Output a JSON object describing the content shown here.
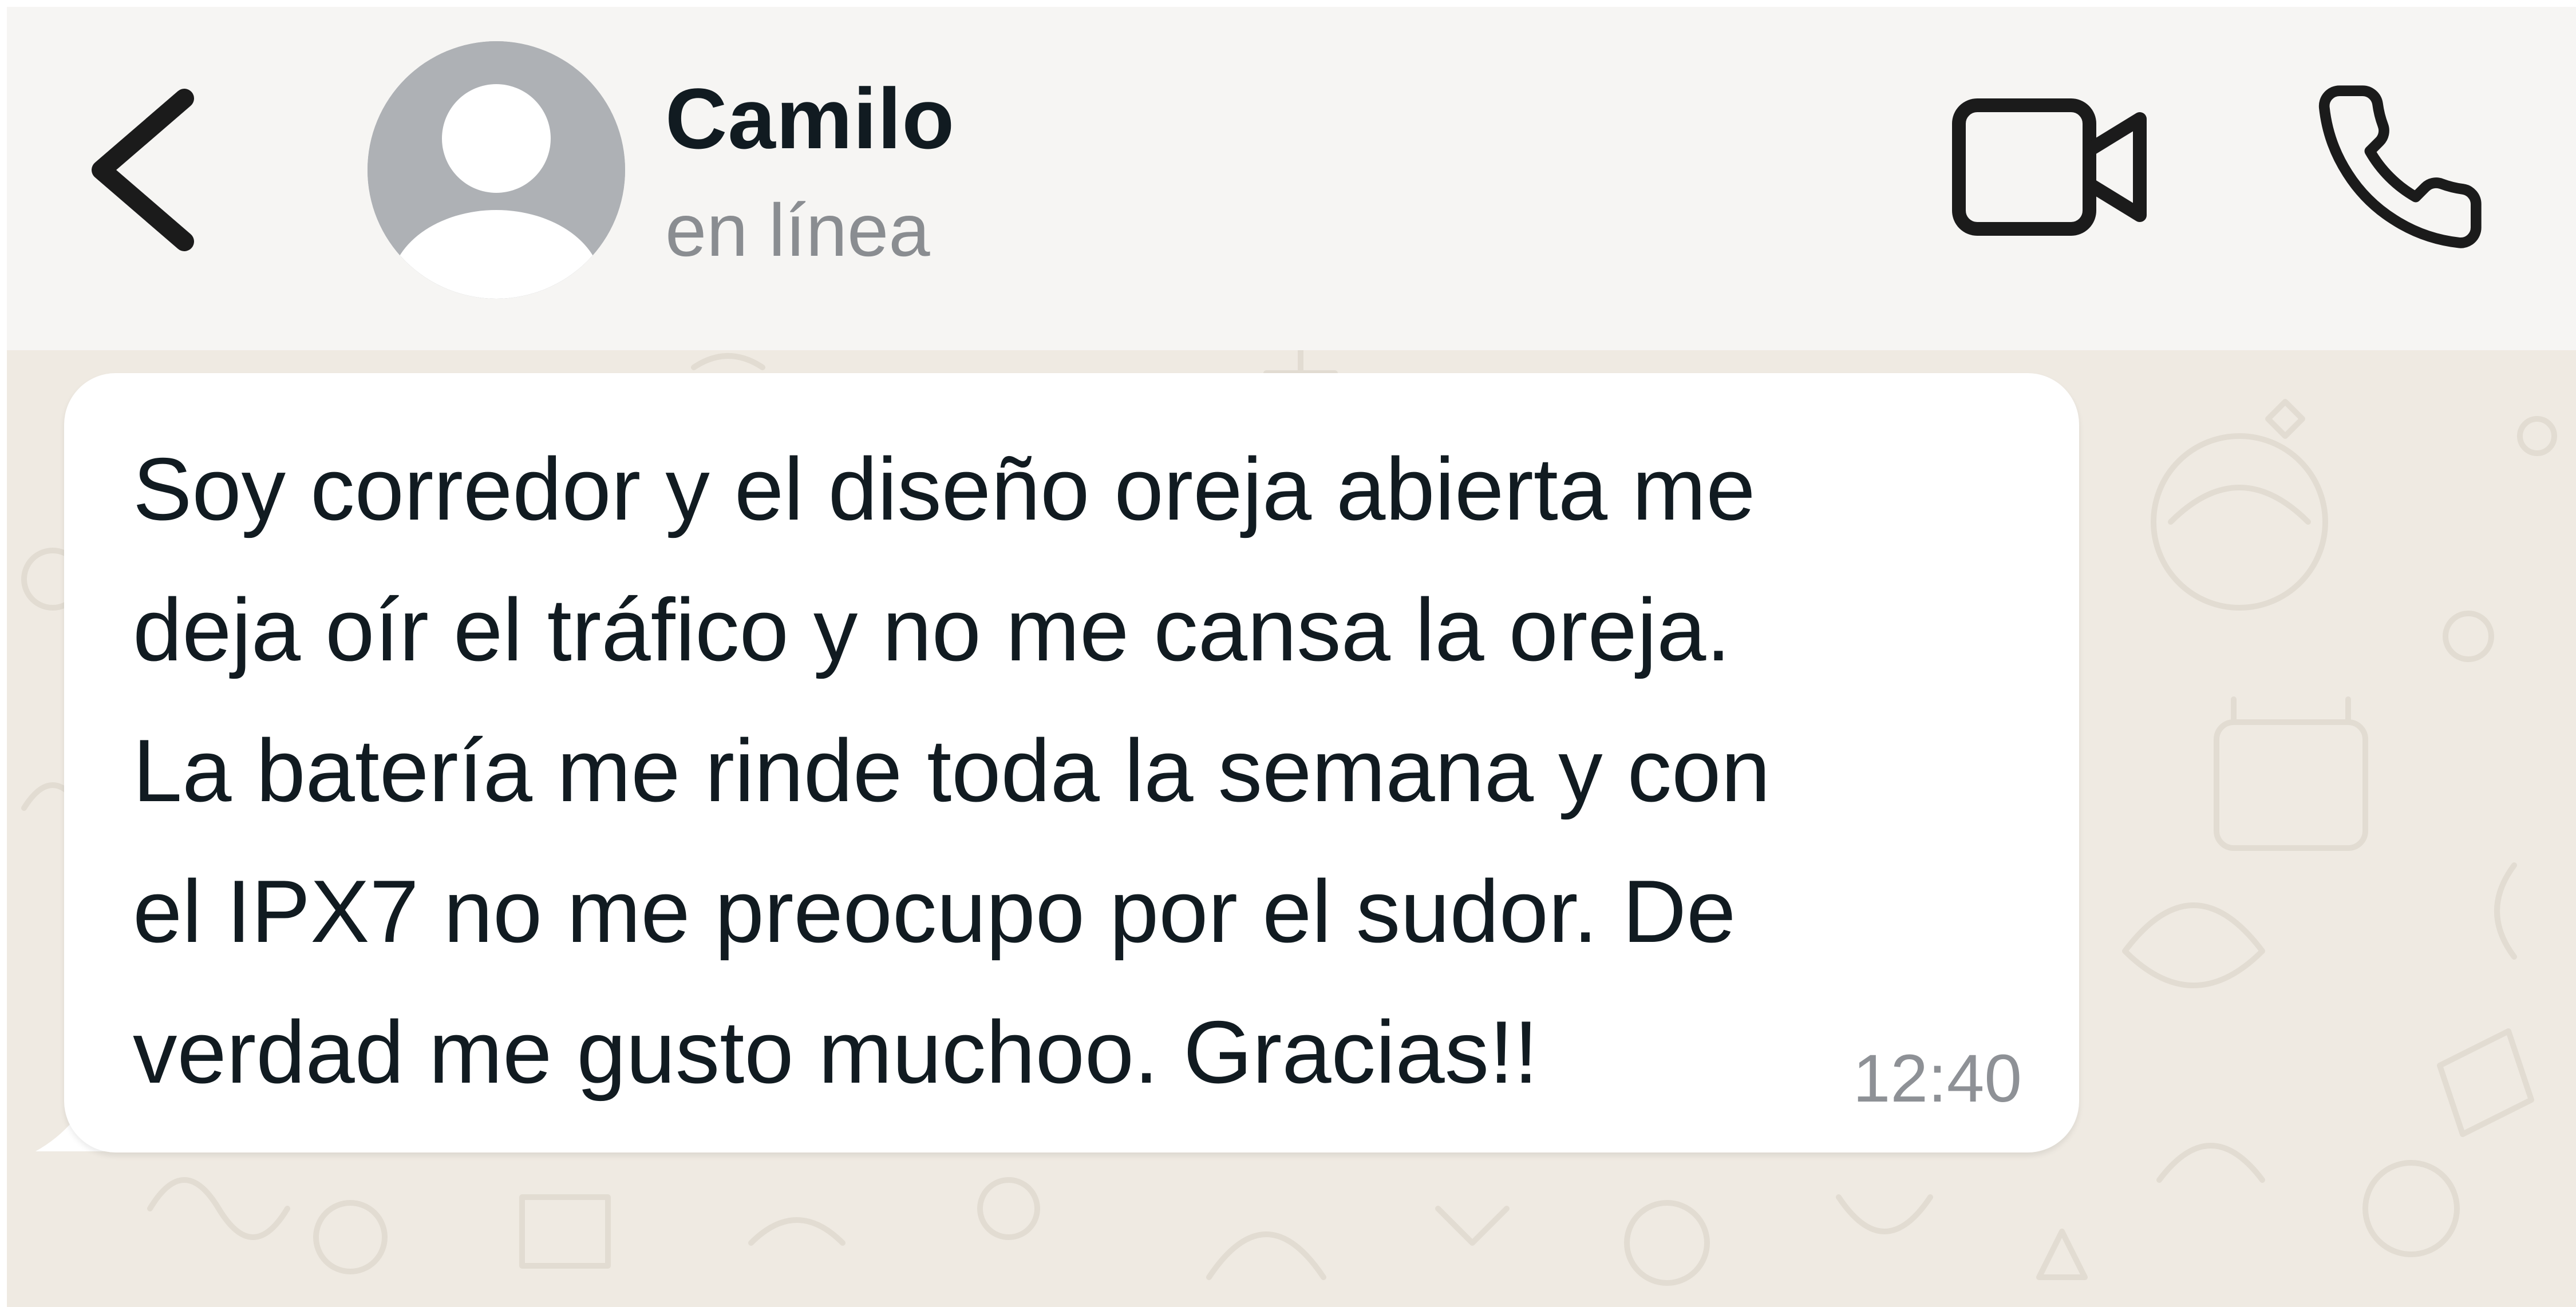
{
  "header": {
    "back_icon": "chevron-left-icon",
    "avatar_icon": "default-user-avatar",
    "contact_name": "Camilo",
    "status": "en línea",
    "video_icon": "video-camera-icon",
    "call_icon": "phone-icon"
  },
  "chat": {
    "wallpaper": "doodle-pattern",
    "messages": [
      {
        "direction": "incoming",
        "text": "Soy corredor y el diseño oreja abierta me\ndeja oír el tráfico y no me cansa la oreja.\nLa batería me rinde toda la semana y con\nel IPX7 no me preocupo por el sudor. De\nverdad me gusto muchoo. Gracias!!",
        "time": "12:40"
      }
    ]
  },
  "colors": {
    "header_bg": "#f6f5f3",
    "chat_bg": "#efeae2",
    "bubble_bg": "#ffffff",
    "text": "#111b21",
    "muted": "#8a8d91",
    "avatar": "#aeb1b5"
  }
}
